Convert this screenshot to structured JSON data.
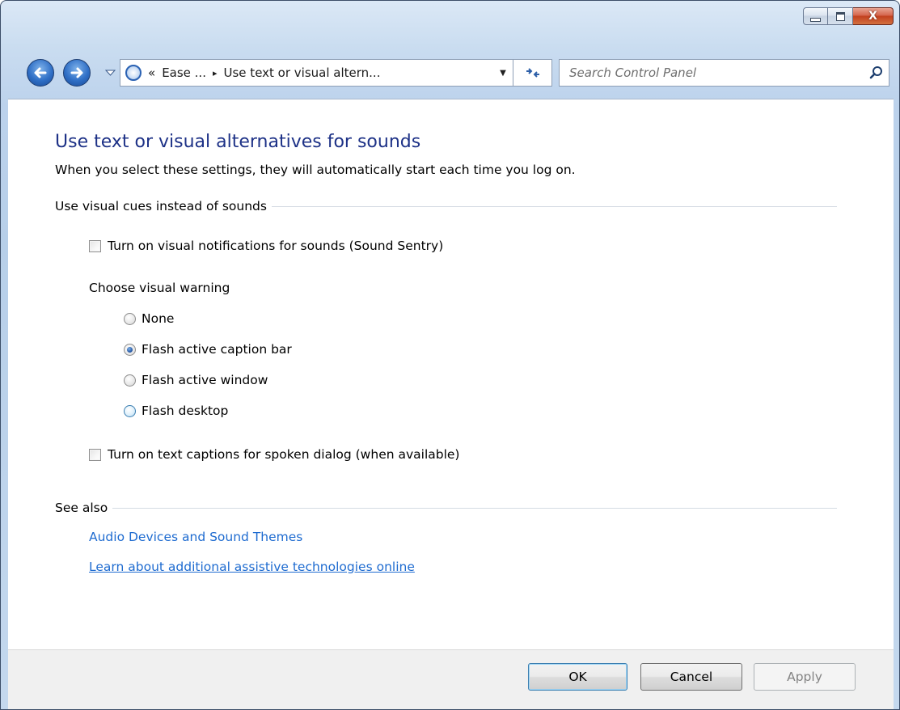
{
  "window": {
    "caption_buttons": {
      "minimize": "minimize-icon",
      "maximize": "maximize-icon",
      "close": "X"
    }
  },
  "navbar": {
    "breadcrumb": {
      "overflow": "«",
      "parent": "Ease ...",
      "separator": "▸",
      "current": "Use text or visual altern..."
    },
    "search": {
      "placeholder": "Search Control Panel",
      "value": ""
    }
  },
  "page": {
    "title": "Use text or visual alternatives for sounds",
    "subtitle": "When you select these settings, they will automatically start each time you log on."
  },
  "visual_cues": {
    "group_label": "Use visual cues instead of sounds",
    "sound_sentry": {
      "label": "Turn on visual notifications for sounds (Sound Sentry)",
      "checked": false
    },
    "warning_heading": "Choose visual warning",
    "options": [
      {
        "label": "None",
        "checked": false
      },
      {
        "label": "Flash active caption bar",
        "checked": true
      },
      {
        "label": "Flash active window",
        "checked": false
      },
      {
        "label": "Flash desktop",
        "checked": false
      }
    ],
    "text_captions": {
      "label": "Turn on text captions for spoken dialog (when available)",
      "checked": false
    }
  },
  "see_also": {
    "group_label": "See also",
    "links": [
      {
        "label": "Audio Devices and Sound Themes"
      },
      {
        "label": "Learn about additional assistive technologies online"
      }
    ]
  },
  "footer": {
    "ok_label": "OK",
    "cancel_label": "Cancel",
    "apply_label": "Apply"
  },
  "colors": {
    "title": "#1e3287",
    "link": "#1e6bd0",
    "window_frame": "#c9dcf0"
  }
}
